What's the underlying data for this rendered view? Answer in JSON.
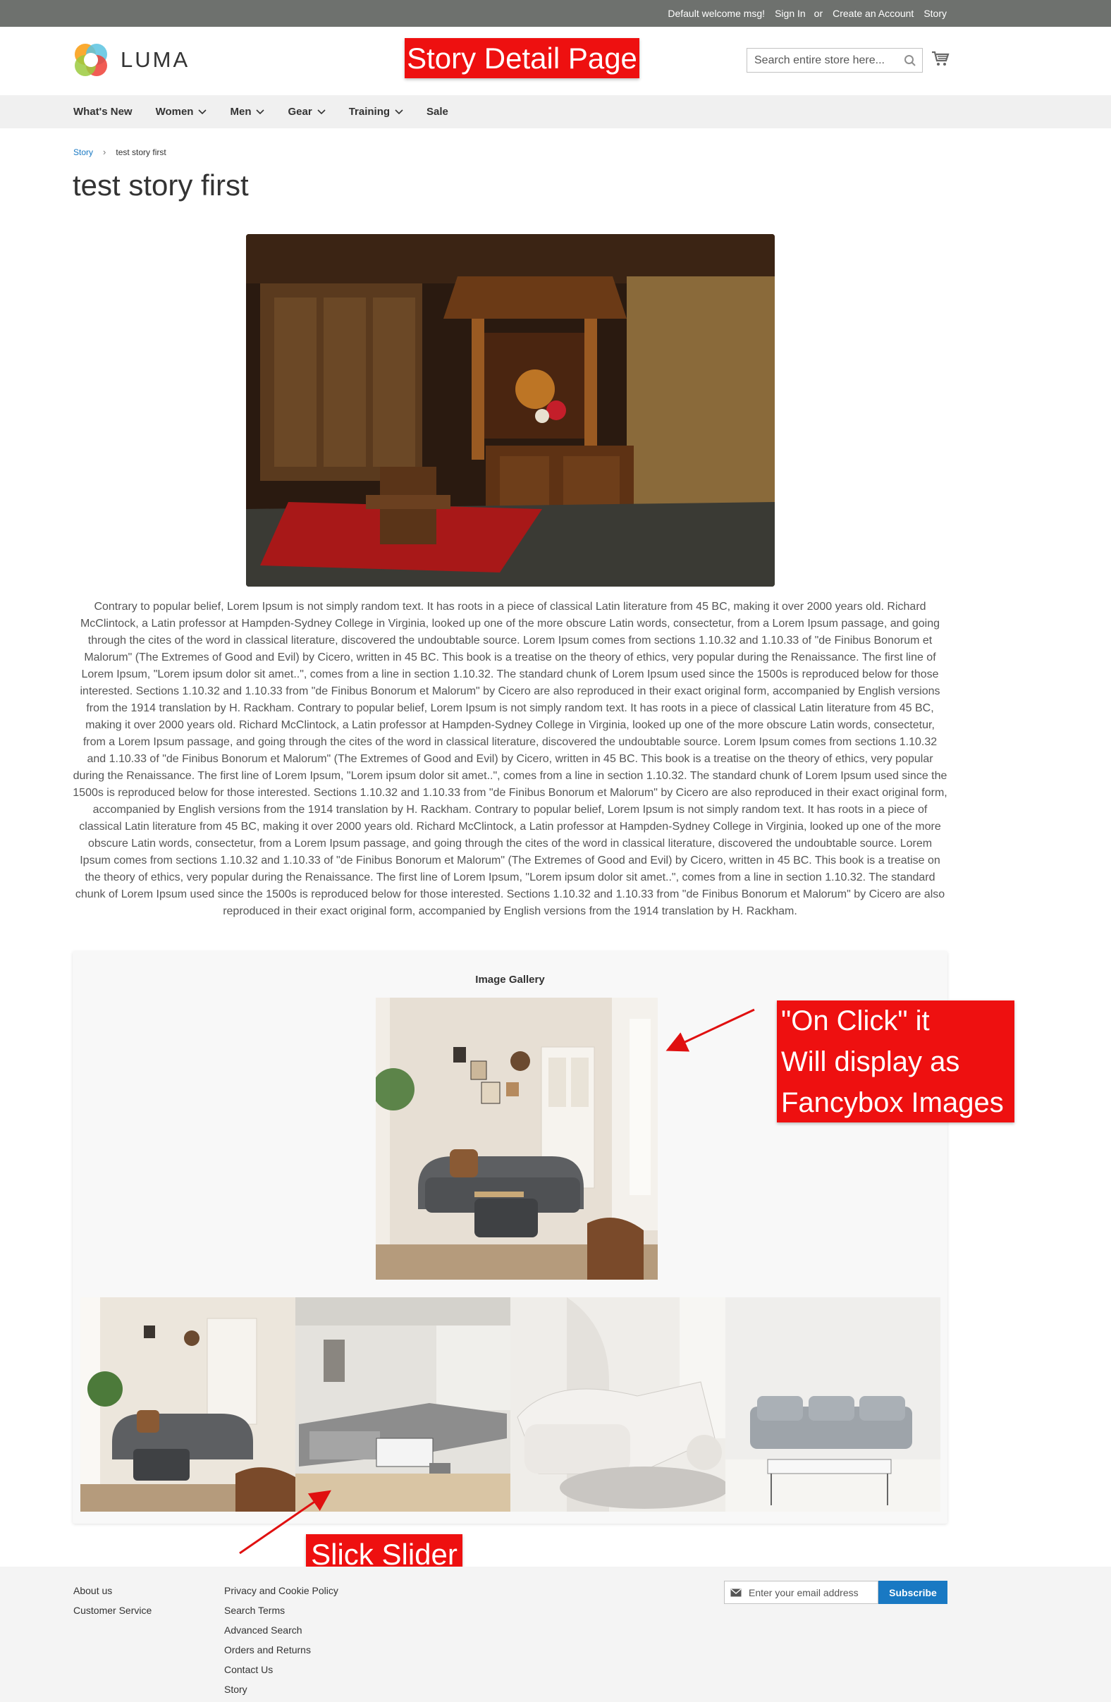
{
  "top_panel": {
    "welcome": "Default welcome msg!",
    "sign_in": "Sign In",
    "or": "or",
    "create_account": "Create an Account",
    "story": "Story"
  },
  "header": {
    "logo_text": "LUMA",
    "search_placeholder": "Search entire store here...",
    "annotation": "Story Detail Page"
  },
  "nav": {
    "items": [
      {
        "label": "What's New",
        "has_dropdown": false
      },
      {
        "label": "Women",
        "has_dropdown": true
      },
      {
        "label": "Men",
        "has_dropdown": true
      },
      {
        "label": "Gear",
        "has_dropdown": true
      },
      {
        "label": "Training",
        "has_dropdown": true
      },
      {
        "label": "Sale",
        "has_dropdown": false
      }
    ]
  },
  "breadcrumbs": {
    "parent": "Story",
    "current": "test story first"
  },
  "page_title": "test story first",
  "body_text": "Contrary to popular belief, Lorem Ipsum is not simply random text. It has roots in a piece of classical Latin literature from 45 BC, making it over 2000 years old. Richard McClintock, a Latin professor at Hampden-Sydney College in Virginia, looked up one of the more obscure Latin words, consectetur, from a Lorem Ipsum passage, and going through the cites of the word in classical literature, discovered the undoubtable source. Lorem Ipsum comes from sections 1.10.32 and 1.10.33 of \"de Finibus Bonorum et Malorum\" (The Extremes of Good and Evil) by Cicero, written in 45 BC. This book is a treatise on the theory of ethics, very popular during the Renaissance. The first line of Lorem Ipsum, \"Lorem ipsum dolor sit amet..\", comes from a line in section 1.10.32. The standard chunk of Lorem Ipsum used since the 1500s is reproduced below for those interested. Sections 1.10.32 and 1.10.33 from \"de Finibus Bonorum et Malorum\" by Cicero are also reproduced in their exact original form, accompanied by English versions from the 1914 translation by H. Rackham. Contrary to popular belief, Lorem Ipsum is not simply random text. It has roots in a piece of classical Latin literature from 45 BC, making it over 2000 years old. Richard McClintock, a Latin professor at Hampden-Sydney College in Virginia, looked up one of the more obscure Latin words, consectetur, from a Lorem Ipsum passage, and going through the cites of the word in classical literature, discovered the undoubtable source. Lorem Ipsum comes from sections 1.10.32 and 1.10.33 of \"de Finibus Bonorum et Malorum\" (The Extremes of Good and Evil) by Cicero, written in 45 BC. This book is a treatise on the theory of ethics, very popular during the Renaissance. The first line of Lorem Ipsum, \"Lorem ipsum dolor sit amet..\", comes from a line in section 1.10.32. The standard chunk of Lorem Ipsum used since the 1500s is reproduced below for those interested. Sections 1.10.32 and 1.10.33 from \"de Finibus Bonorum et Malorum\" by Cicero are also reproduced in their exact original form, accompanied by English versions from the 1914 translation by H. Rackham. Contrary to popular belief, Lorem Ipsum is not simply random text. It has roots in a piece of classical Latin literature from 45 BC, making it over 2000 years old. Richard McClintock, a Latin professor at Hampden-Sydney College in Virginia, looked up one of the more obscure Latin words, consectetur, from a Lorem Ipsum passage, and going through the cites of the word in classical literature, discovered the undoubtable source. Lorem Ipsum comes from sections 1.10.32 and 1.10.33 of \"de Finibus Bonorum et Malorum\" (The Extremes of Good and Evil) by Cicero, written in 45 BC. This book is a treatise on the theory of ethics, very popular during the Renaissance. The first line of Lorem Ipsum, \"Lorem ipsum dolor sit amet..\", comes from a line in section 1.10.32. The standard chunk of Lorem Ipsum used since the 1500s is reproduced below for those interested. Sections 1.10.32 and 1.10.33 from \"de Finibus Bonorum et Malorum\" by Cicero are also reproduced in their exact original form, accompanied by English versions from the 1914 translation by H. Rackham.",
  "gallery": {
    "title": "Image Gallery",
    "annotation_click": [
      "\"On Click\" it",
      "Will display as",
      "Fancybox Images"
    ],
    "annotation_slider": "Slick Slider"
  },
  "footer": {
    "col1": [
      "About us",
      "Customer Service"
    ],
    "col2": [
      "Privacy and Cookie Policy",
      "Search Terms",
      "Advanced Search",
      "Orders and Returns",
      "Contact Us",
      "Story"
    ],
    "newsletter_placeholder": "Enter your email address",
    "subscribe_label": "Subscribe"
  },
  "colors": {
    "top_panel": "#6e716e",
    "nav_bg": "#f0f0f0",
    "link": "#1979c3",
    "annotation": "#ee1010",
    "subscribe": "#1979c3"
  }
}
